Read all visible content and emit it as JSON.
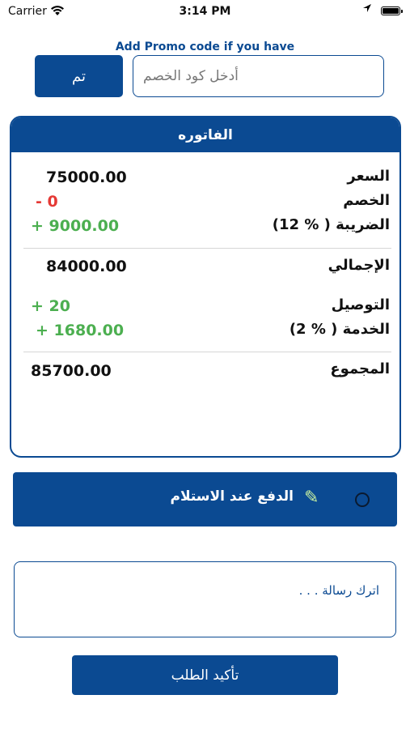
{
  "status_bar": {
    "carrier": "Carrier",
    "time": "3:14 PM"
  },
  "promo": {
    "hint": "Add Promo code if you have",
    "placeholder": "أدخل كود الخصم",
    "done_label": "تم"
  },
  "invoice": {
    "title": "الفاتوره",
    "price": {
      "label": "السعر",
      "value": "75000.00"
    },
    "discount": {
      "label": "الخصم",
      "value": "- 0"
    },
    "tax": {
      "label": "الضريبة ( % 12)",
      "value": "+ 9000.00"
    },
    "subtotal": {
      "label": "الإجمالي",
      "value": "84000.00"
    },
    "delivery": {
      "label": "التوصيل",
      "value": "+ 20"
    },
    "service": {
      "label": "الخدمة ( % 2)",
      "value": "+ 1680.00"
    },
    "total": {
      "label": "المجموع",
      "value": "85700.00"
    }
  },
  "payment": {
    "cash_on_delivery_label": "الدفع عند الاستلام",
    "icon": "pencil-icon"
  },
  "message": {
    "placeholder": "اترك رسالة . . ."
  },
  "confirm_label": "تأكيد الطلب",
  "colors": {
    "primary": "#0b4a92",
    "negative": "#e53935",
    "positive": "#4caf50"
  }
}
